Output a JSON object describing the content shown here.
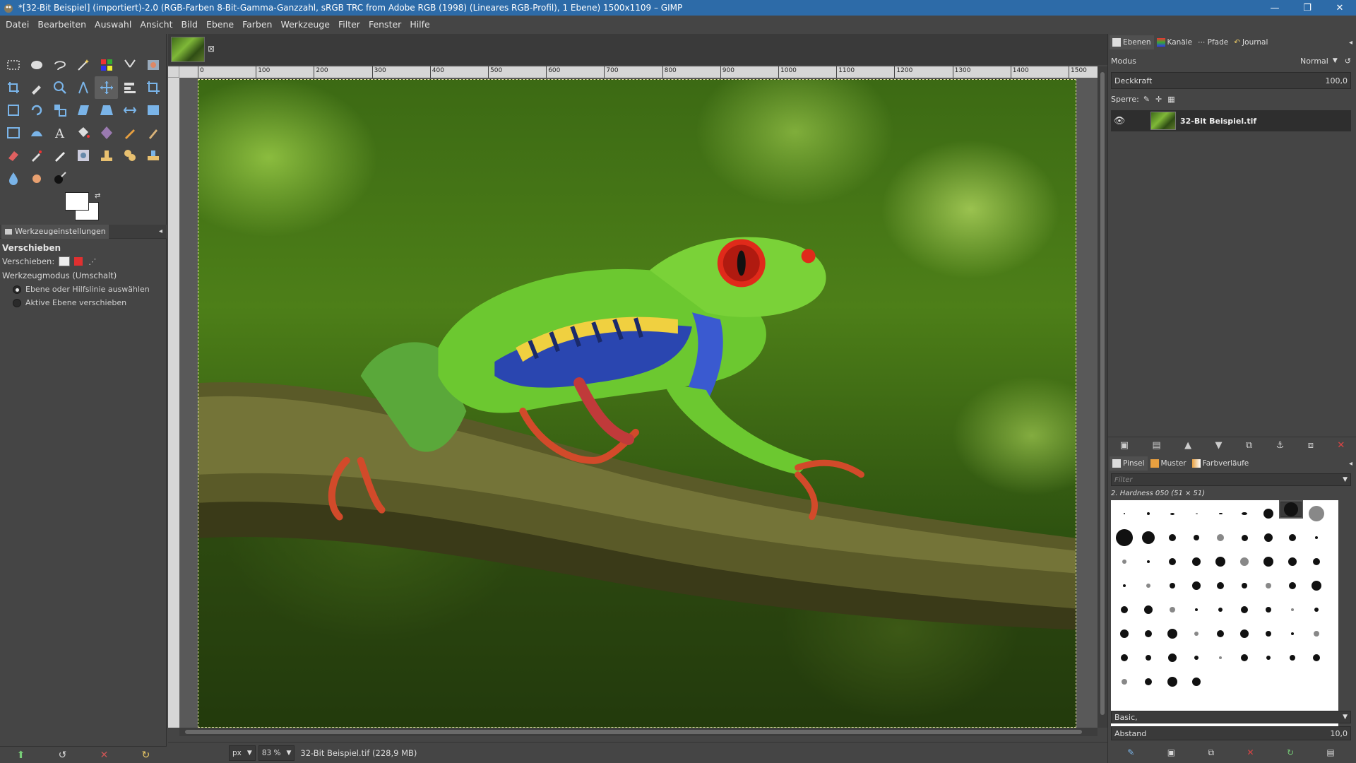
{
  "window": {
    "title": "*[32-Bit Beispiel] (importiert)-2.0 (RGB-Farben 8-Bit-Gamma-Ganzzahl, sRGB TRC from Adobe RGB (1998) (Lineares RGB-Profil), 1 Ebene) 1500x1109 – GIMP",
    "minimize": "—",
    "restore": "❐",
    "close": "✕"
  },
  "menu": [
    "Datei",
    "Bearbeiten",
    "Auswahl",
    "Ansicht",
    "Bild",
    "Ebene",
    "Farben",
    "Werkzeuge",
    "Filter",
    "Fenster",
    "Hilfe"
  ],
  "tool_options": {
    "tab_label": "Werkzeugeinstellungen",
    "title": "Verschieben",
    "move_label": "Verschieben:",
    "mode_label": "Werkzeugmodus (Umschalt)",
    "option_1": "Ebene oder Hilfslinie auswählen",
    "option_2": "Aktive Ebene verschieben"
  },
  "ruler": {
    "labels": [
      "0",
      "100",
      "200",
      "300",
      "400",
      "500",
      "600",
      "700",
      "800",
      "900",
      "1000",
      "1100",
      "1200",
      "1300",
      "1400",
      "1500"
    ]
  },
  "status": {
    "unit": "px",
    "zoom": "83 %",
    "file_info": "32-Bit Beispiel.tif (228,9 MB)"
  },
  "layers_dock": {
    "tabs": [
      "Ebenen",
      "Kanäle",
      "Pfade",
      "Journal"
    ],
    "mode_label": "Modus",
    "mode_value": "Normal",
    "opacity_label": "Deckkraft",
    "opacity_value": "100,0",
    "lock_label": "Sperre:",
    "layer_name": "32-Bit Beispiel.tif"
  },
  "brushes_dock": {
    "tabs": [
      "Pinsel",
      "Muster",
      "Farbverläufe"
    ],
    "filter_placeholder": "Filter",
    "selected_brush": "2. Hardness 050 (51 × 51)",
    "tag_value": "Basic,",
    "spacing_label": "Abstand",
    "spacing_value": "10,0"
  },
  "colors": {
    "titlebar": "#2d6ba8",
    "panel": "#454545",
    "foreground": "#ffffff",
    "background": "#ffffff"
  }
}
